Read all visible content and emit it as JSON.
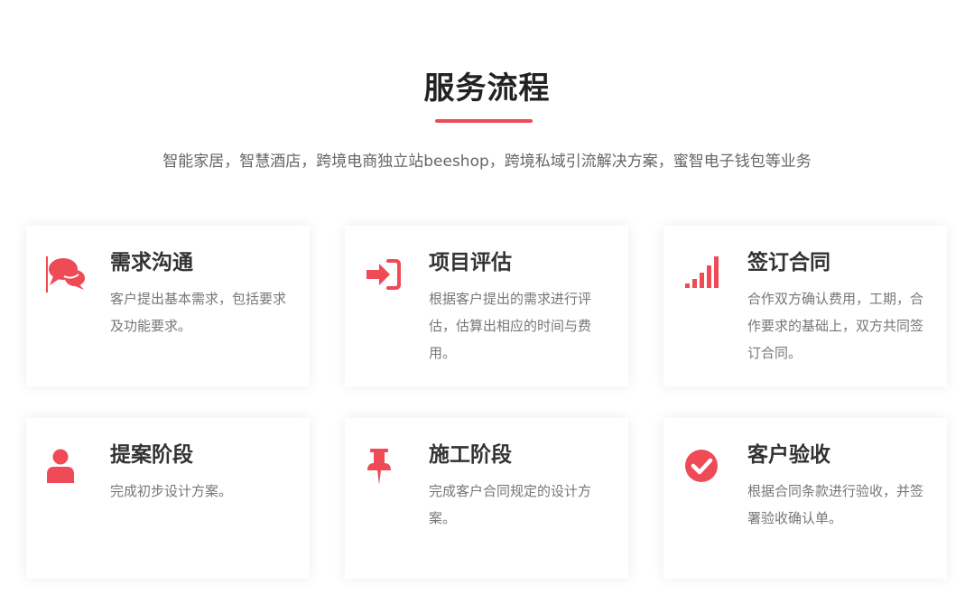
{
  "header": {
    "title": "服务流程",
    "subtitle": "智能家居，智慧酒店，跨境电商独立站beeshop，跨境私域引流解决方案，蜜智电子钱包等业务",
    "accent_color": "#ee4b57"
  },
  "cards": [
    {
      "title": "需求沟通",
      "desc": "客户提出基本需求，包括要求及功能要求。",
      "icon": "chat-bubbles-icon"
    },
    {
      "title": "项目评估",
      "desc": "根据客户提出的需求进行评估，估算出相应的时间与费用。",
      "icon": "sign-in-arrow-icon"
    },
    {
      "title": "签订合同",
      "desc": "合作双方确认费用，工期，合作要求的基础上，双方共同签订合同。",
      "icon": "signal-bars-icon"
    },
    {
      "title": "提案阶段",
      "desc": "完成初步设计方案。",
      "icon": "user-icon"
    },
    {
      "title": "施工阶段",
      "desc": "完成客户合同规定的设计方案。",
      "icon": "pushpin-icon"
    },
    {
      "title": "客户验收",
      "desc": "根据合同条款进行验收，并签署验收确认单。",
      "icon": "check-circle-icon"
    }
  ]
}
